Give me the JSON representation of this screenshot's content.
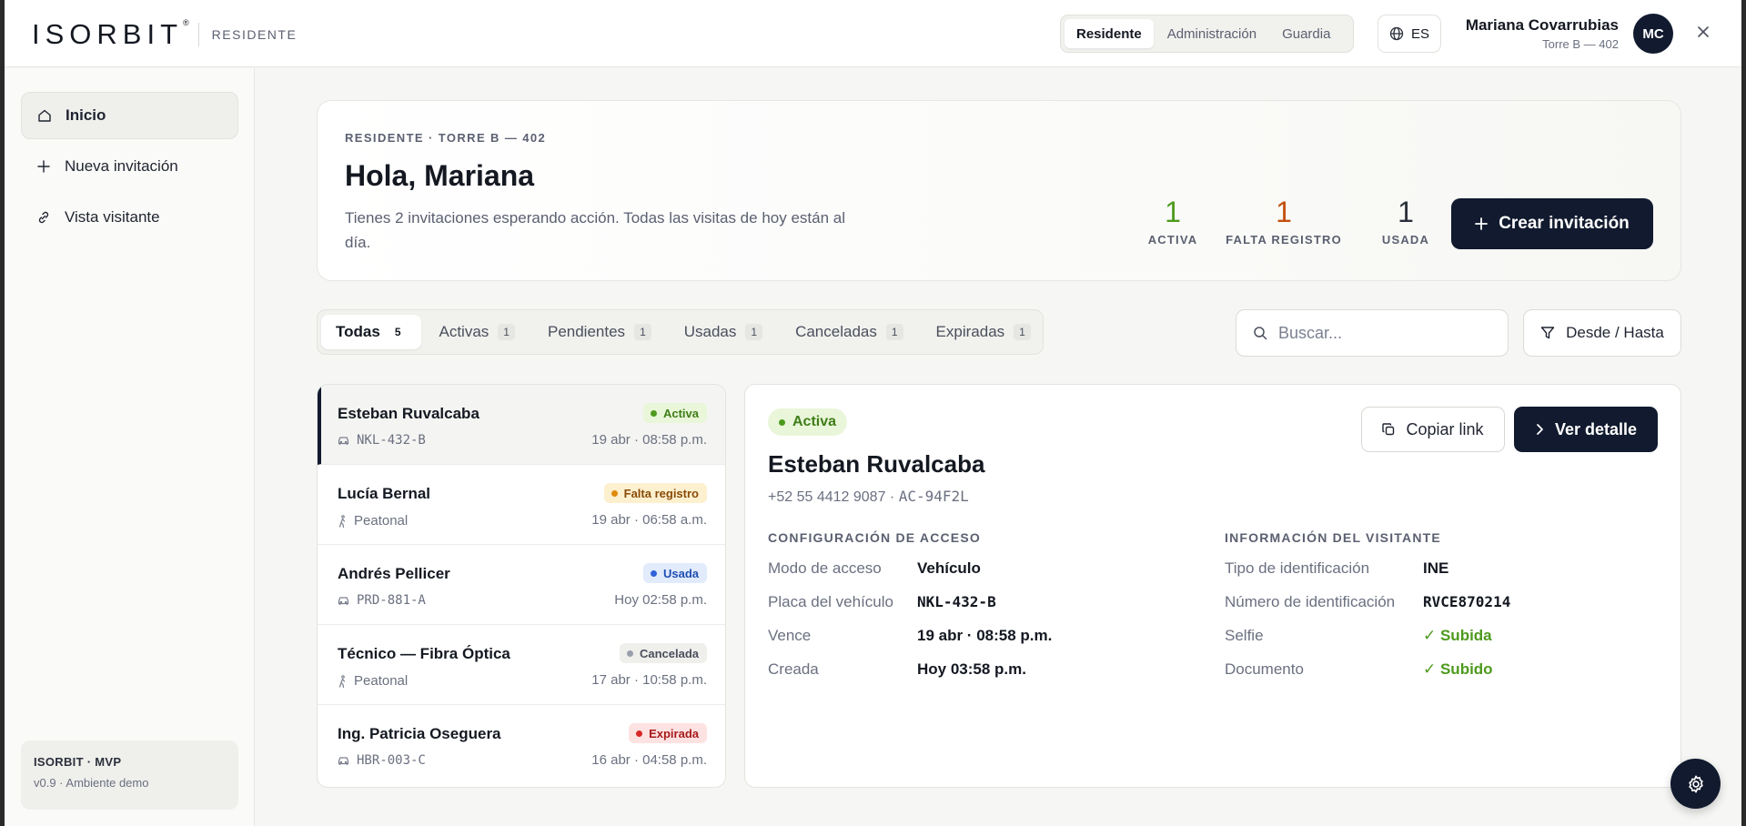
{
  "header": {
    "brand": "ISORBIT",
    "brand_mark": "®",
    "role_label": "RESIDENTE",
    "role_switch": [
      "Residente",
      "Administración",
      "Guardia"
    ],
    "language": "ES",
    "user_name": "Mariana Covarrubias",
    "user_unit": "Torre B — 402",
    "avatar_initials": "MC"
  },
  "sidebar": {
    "items": [
      {
        "label": "Inicio",
        "icon": "home-icon"
      },
      {
        "label": "Nueva invitación",
        "icon": "plus-icon"
      },
      {
        "label": "Vista visitante",
        "icon": "link-icon"
      }
    ],
    "footer_title": "ISORBIT · MVP",
    "footer_version": "v0.9 · Ambiente demo"
  },
  "hero": {
    "eyebrow": "RESIDENTE · TORRE B — 402",
    "title": "Hola, Mariana",
    "description": "Tienes 2 invitaciones esperando acción. Todas las visitas de hoy están al día.",
    "stats": [
      {
        "value": "1",
        "label": "ACTIVA",
        "color": "#4e9a1e"
      },
      {
        "value": "1",
        "label": "FALTA REGISTRO",
        "color": "#c2500e"
      },
      {
        "value": "1",
        "label": "USADA",
        "color": "#2a2f3a"
      }
    ],
    "create_button": "Crear invitación"
  },
  "tabs": [
    {
      "label": "Todas",
      "count": "5"
    },
    {
      "label": "Activas",
      "count": "1"
    },
    {
      "label": "Pendientes",
      "count": "1"
    },
    {
      "label": "Usadas",
      "count": "1"
    },
    {
      "label": "Canceladas",
      "count": "1"
    },
    {
      "label": "Expiradas",
      "count": "1"
    }
  ],
  "search": {
    "placeholder": "Buscar..."
  },
  "date_range_button": "Desde / Hasta",
  "invitations": [
    {
      "name": "Esteban Ruvalcaba",
      "sub": "NKL-432-B",
      "sub_icon": "car-icon",
      "status": "Activa",
      "date": "19 abr · 08:58 p.m."
    },
    {
      "name": "Lucía Bernal",
      "sub": "Peatonal",
      "sub_icon": "walk-icon",
      "status": "Falta registro",
      "date": "19 abr · 06:58 a.m."
    },
    {
      "name": "Andrés Pellicer",
      "sub": "PRD-881-A",
      "sub_icon": "car-icon",
      "status": "Usada",
      "date": "Hoy 02:58 p.m."
    },
    {
      "name": "Técnico — Fibra Óptica",
      "sub": "Peatonal",
      "sub_icon": "walk-icon",
      "status": "Cancelada",
      "date": "17 abr · 10:58 p.m."
    },
    {
      "name": "Ing. Patricia Oseguera",
      "sub": "HBR-003-C",
      "sub_icon": "car-icon",
      "status": "Expirada",
      "date": "16 abr · 04:58 p.m."
    }
  ],
  "status_colors": {
    "Activa": {
      "bg": "#e9f6d9",
      "fg": "#3f7d18",
      "dot": "#4e9a1e"
    },
    "Falta registro": {
      "bg": "#fdf0cf",
      "fg": "#8a4b08",
      "dot": "#e08a0b"
    },
    "Usada": {
      "bg": "#e1ebfb",
      "fg": "#1f4fb4",
      "dot": "#2f62d8"
    },
    "Cancelada": {
      "bg": "#efefec",
      "fg": "#4a4f5c",
      "dot": "#9aa0ab"
    },
    "Expirada": {
      "bg": "#fde2e2",
      "fg": "#a81b1b",
      "dot": "#d62828"
    }
  },
  "detail": {
    "status": "Activa",
    "name": "Esteban Ruvalcaba",
    "phone": "+52 55 4412 9087",
    "code": "AC-94F2L",
    "copy_button": "Copiar link",
    "view_button": "Ver detalle",
    "access_title": "CONFIGURACIÓN DE ACCESO",
    "access": [
      {
        "k": "Modo de acceso",
        "v": "Vehículo"
      },
      {
        "k": "Placa del vehículo",
        "v": "NKL-432-B"
      },
      {
        "k": "Vence",
        "v": "19 abr · 08:58 p.m."
      },
      {
        "k": "Creada",
        "v": "Hoy 03:58 p.m."
      }
    ],
    "visitor_title": "INFORMACIÓN DEL VISITANTE",
    "visitor": [
      {
        "k": "Tipo de identificación",
        "v": "INE"
      },
      {
        "k": "Número de identificación",
        "v": "RVCE870214"
      },
      {
        "k": "Selfie",
        "v": "✓ Subida"
      },
      {
        "k": "Documento",
        "v": "✓ Subido"
      }
    ]
  }
}
